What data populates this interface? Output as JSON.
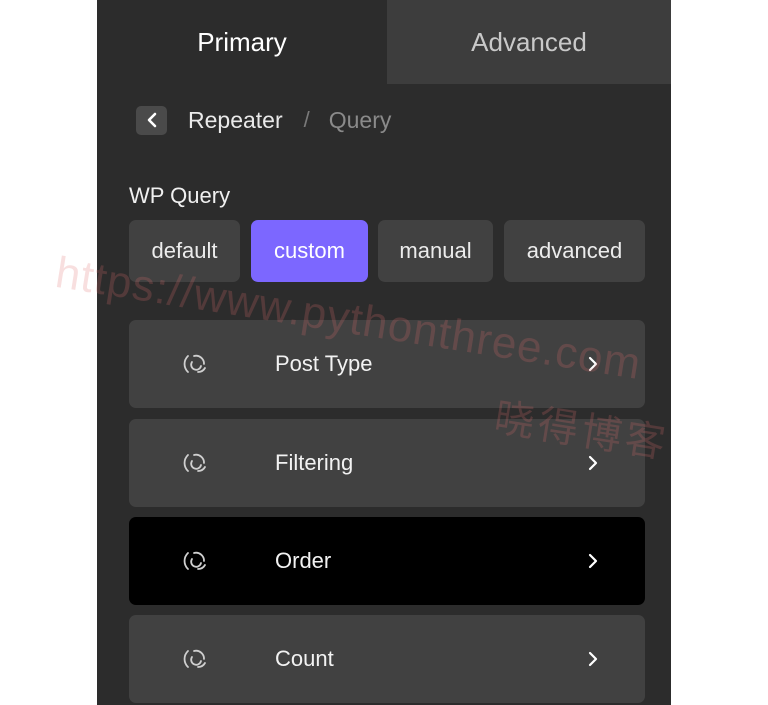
{
  "tabs": [
    {
      "label": "Primary",
      "active": true
    },
    {
      "label": "Advanced",
      "active": false
    }
  ],
  "breadcrumb": {
    "back_icon": "chevron-left-icon",
    "parent": "Repeater",
    "separator": "/",
    "current": "Query"
  },
  "query": {
    "label": "WP Query",
    "options": [
      "default",
      "custom",
      "manual",
      "advanced"
    ],
    "selected": "custom"
  },
  "rows": [
    {
      "label": "Post Type",
      "icon": "loading-swirl-icon"
    },
    {
      "label": "Filtering",
      "icon": "loading-swirl-icon"
    },
    {
      "label": "Order",
      "icon": "loading-swirl-icon"
    },
    {
      "label": "Count",
      "icon": "loading-swirl-icon"
    }
  ],
  "watermark": {
    "url": "https://www.pythonthree.com",
    "name": "晓得博客"
  },
  "colors": {
    "panel": "#2c2c2c",
    "tab_inactive": "#3d3d3d",
    "control": "#414141",
    "accent": "#7c67ff",
    "row_highlight": "#000000"
  }
}
